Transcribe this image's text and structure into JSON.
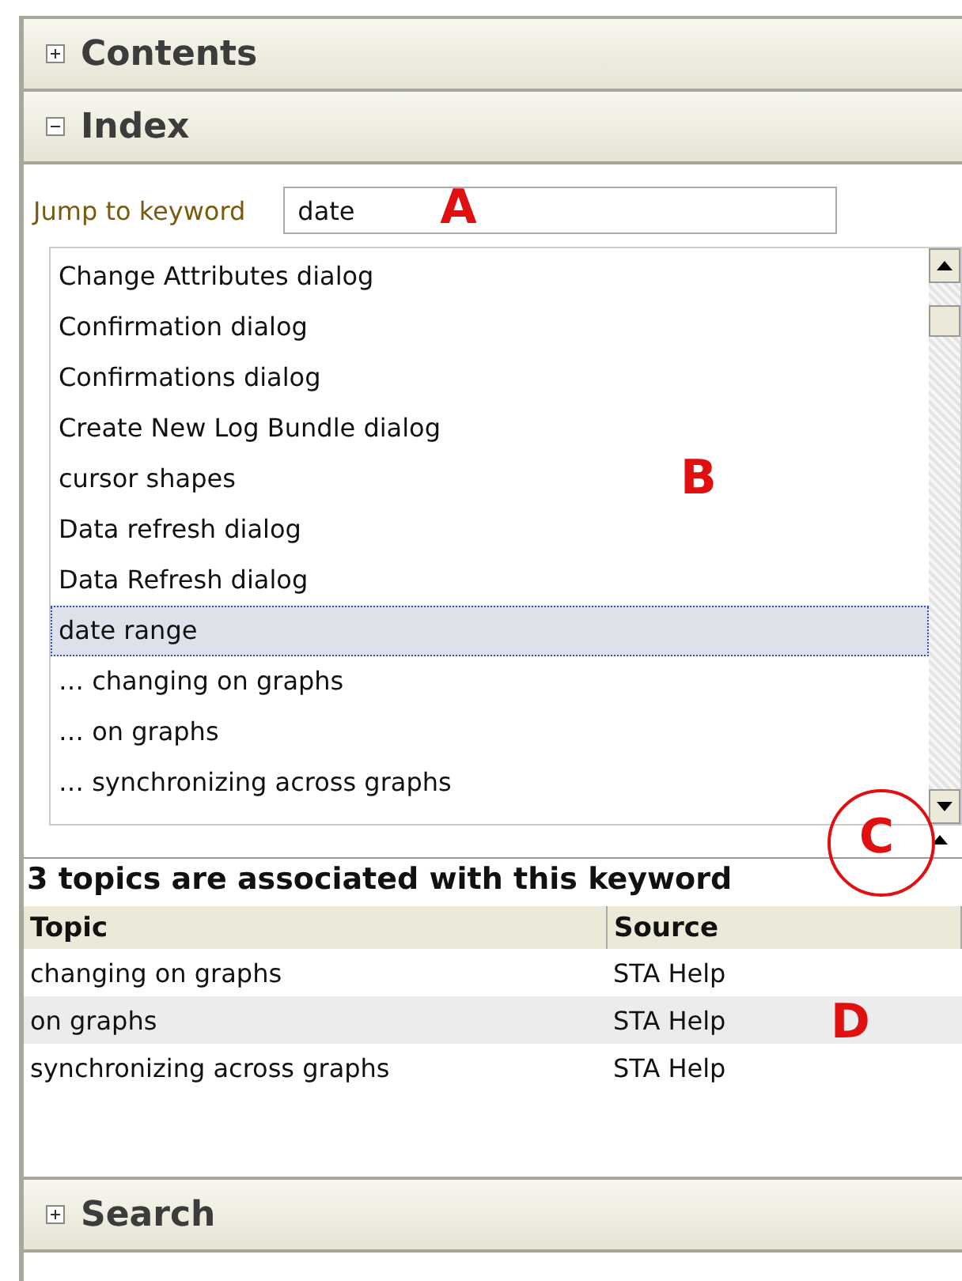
{
  "sections": [
    {
      "title": "Contents",
      "expanded": false
    },
    {
      "title": "Index",
      "expanded": true
    },
    {
      "title": "Search",
      "expanded": false
    }
  ],
  "keyword": {
    "label": "Jump to keyword",
    "value": "date"
  },
  "index_list": [
    {
      "text": "Change Attributes dialog",
      "selected": false
    },
    {
      "text": "Confirmation dialog",
      "selected": false
    },
    {
      "text": "Confirmations dialog",
      "selected": false
    },
    {
      "text": "Create New Log Bundle dialog",
      "selected": false
    },
    {
      "text": "cursor shapes",
      "selected": false
    },
    {
      "text": "Data refresh dialog",
      "selected": false
    },
    {
      "text": "Data Refresh dialog",
      "selected": false
    },
    {
      "text": "date range",
      "selected": true
    },
    {
      "text": "… changing on graphs",
      "selected": false
    },
    {
      "text": "… on graphs",
      "selected": false
    },
    {
      "text": "… synchronizing across graphs",
      "selected": false
    }
  ],
  "topics_heading": "3 topics are associated with this keyword",
  "table": {
    "columns": [
      "Topic",
      "Source"
    ],
    "rows": [
      {
        "cells": [
          "changing on graphs",
          "STA Help"
        ],
        "highlighted": false
      },
      {
        "cells": [
          "on graphs",
          "STA Help"
        ],
        "highlighted": true
      },
      {
        "cells": [
          "synchronizing across graphs",
          "STA Help"
        ],
        "highlighted": false
      }
    ]
  },
  "callouts": [
    {
      "label": "A",
      "kind": "letter"
    },
    {
      "label": "B",
      "kind": "letter"
    },
    {
      "label": "C",
      "kind": "circled"
    },
    {
      "label": "D",
      "kind": "letter"
    }
  ]
}
